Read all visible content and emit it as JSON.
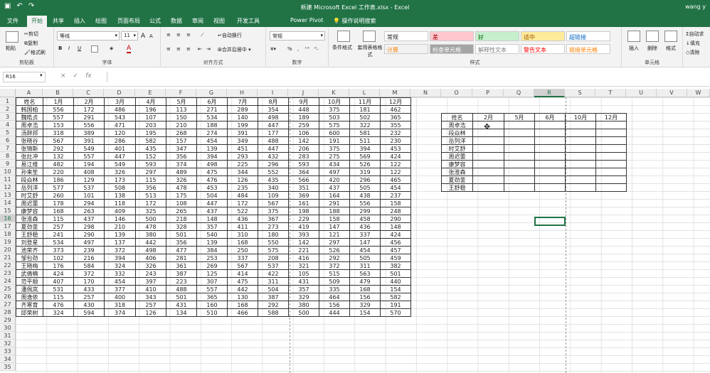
{
  "titlebar": {
    "title": "新建 Microsoft Excel 工作表.xlsx  -  Excel",
    "user": "wang y"
  },
  "menu": {
    "tabs": [
      "文件",
      "开始",
      "共享",
      "插入",
      "绘图",
      "页面布局",
      "公式",
      "数据",
      "审阅",
      "视图",
      "开发工具",
      "Power Pivot",
      "操作说明搜索"
    ],
    "active": "开始"
  },
  "ribbon": {
    "clipboard": {
      "paste": "粘贴",
      "cut": "剪切",
      "copy": "复制",
      "format_painter": "格式刷",
      "label": "剪贴板"
    },
    "font": {
      "name": "等线",
      "size": "11",
      "bold": "B",
      "italic": "I",
      "underline": "U",
      "grow": "A",
      "shrink": "A",
      "color": "A",
      "label": "字体"
    },
    "align": {
      "wrap": "自动换行",
      "merge": "合并后居中",
      "label": "对齐方式"
    },
    "number": {
      "format": "常规",
      "percent": "%",
      "comma": ",",
      "label": "数字"
    },
    "styles": {
      "cond": "条件格式",
      "table": "套用表格格式",
      "label": "样式",
      "cells": [
        {
          "t": "常规",
          "bg": "#ffffff",
          "fg": "#222"
        },
        {
          "t": "差",
          "bg": "#ffc7ce",
          "fg": "#9c0006"
        },
        {
          "t": "好",
          "bg": "#c6efce",
          "fg": "#006100"
        },
        {
          "t": "适中",
          "bg": "#ffeb9c",
          "fg": "#9c5700"
        },
        {
          "t": "超链接",
          "bg": "#ffffff",
          "fg": "#0563c1"
        },
        {
          "t": "计算",
          "bg": "#f2f2f2",
          "fg": "#fa7d00"
        },
        {
          "t": "检查单元格",
          "bg": "#a5a5a5",
          "fg": "#ffffff"
        },
        {
          "t": "解释性文本",
          "bg": "#ffffff",
          "fg": "#7f7f7f"
        },
        {
          "t": "警告文本",
          "bg": "#ffffff",
          "fg": "#ff0000"
        },
        {
          "t": "链接单元格",
          "bg": "#ffffff",
          "fg": "#fa7d00"
        }
      ]
    },
    "cellsgrp": {
      "insert": "插入",
      "delete": "删除",
      "format": "格式",
      "label": "单元格"
    },
    "editing": {
      "autosum": "自动求",
      "fill": "填充",
      "clear": "清除"
    }
  },
  "formula": {
    "namebox": "R16",
    "cancel": "×",
    "enter": "✓",
    "fx": "fx"
  },
  "columns": [
    "A",
    "B",
    "C",
    "D",
    "E",
    "F",
    "G",
    "H",
    "I",
    "J",
    "K",
    "L",
    "M",
    "N",
    "O",
    "P",
    "Q",
    "R",
    "S",
    "T",
    "U",
    "V",
    "W"
  ],
  "selected_col": "R",
  "selected_row": 16,
  "rows": [
    1,
    2,
    3,
    4,
    5,
    6,
    7,
    8,
    9,
    10,
    11,
    12,
    13,
    14,
    15,
    16,
    17,
    18,
    19,
    20,
    21,
    22,
    23,
    24,
    25,
    26,
    27,
    28,
    29,
    30,
    31,
    32,
    33,
    34,
    35
  ],
  "main_table": {
    "header": [
      "姓名",
      "1月",
      "2月",
      "3月",
      "4月",
      "5月",
      "6月",
      "7月",
      "8月",
      "9月",
      "10月",
      "11月",
      "12月"
    ],
    "data": [
      [
        "韩国柏",
        "556",
        "172",
        "486",
        "196",
        "113",
        "271",
        "289",
        "354",
        "448",
        "375",
        "181",
        "462"
      ],
      [
        "魏皓贞",
        "557",
        "291",
        "543",
        "107",
        "150",
        "534",
        "140",
        "498",
        "189",
        "503",
        "502",
        "365"
      ],
      [
        "周卓浩",
        "153",
        "556",
        "471",
        "203",
        "210",
        "188",
        "199",
        "447",
        "259",
        "575",
        "322",
        "355"
      ],
      [
        "汤辞邦",
        "318",
        "389",
        "120",
        "195",
        "268",
        "274",
        "391",
        "177",
        "106",
        "600",
        "581",
        "232"
      ],
      [
        "张晓谷",
        "567",
        "391",
        "286",
        "582",
        "157",
        "454",
        "349",
        "488",
        "142",
        "191",
        "511",
        "230"
      ],
      [
        "张锦斯",
        "292",
        "549",
        "401",
        "435",
        "347",
        "139",
        "451",
        "447",
        "206",
        "375",
        "394",
        "453"
      ],
      [
        "张灶冲",
        "132",
        "557",
        "447",
        "152",
        "356",
        "394",
        "293",
        "432",
        "283",
        "275",
        "569",
        "424"
      ],
      [
        "易江维",
        "482",
        "194",
        "549",
        "593",
        "374",
        "498",
        "225",
        "296",
        "593",
        "434",
        "526",
        "122"
      ],
      [
        "孙来笙",
        "220",
        "408",
        "326",
        "297",
        "489",
        "475",
        "344",
        "552",
        "364",
        "497",
        "319",
        "122"
      ],
      [
        "段焱林",
        "186",
        "129",
        "173",
        "115",
        "326",
        "476",
        "126",
        "435",
        "566",
        "420",
        "296",
        "465"
      ],
      [
        "岳列洋",
        "577",
        "537",
        "508",
        "356",
        "478",
        "453",
        "235",
        "340",
        "351",
        "437",
        "505",
        "454"
      ],
      [
        "时艾舒",
        "260",
        "101",
        "138",
        "513",
        "175",
        "504",
        "484",
        "109",
        "369",
        "164",
        "438",
        "237"
      ],
      [
        "周迟蕾",
        "178",
        "294",
        "118",
        "172",
        "108",
        "447",
        "172",
        "567",
        "161",
        "291",
        "556",
        "158"
      ],
      [
        "康梦容",
        "168",
        "263",
        "409",
        "325",
        "265",
        "437",
        "522",
        "375",
        "198",
        "188",
        "299",
        "248"
      ],
      [
        "张淮森",
        "115",
        "437",
        "146",
        "500",
        "218",
        "148",
        "436",
        "367",
        "229",
        "158",
        "458",
        "290"
      ],
      [
        "夏劲釜",
        "257",
        "298",
        "210",
        "478",
        "328",
        "357",
        "411",
        "273",
        "419",
        "147",
        "436",
        "148"
      ],
      [
        "王舒稳",
        "241",
        "290",
        "139",
        "380",
        "501",
        "540",
        "310",
        "180",
        "393",
        "121",
        "337",
        "424"
      ],
      [
        "刘登星",
        "534",
        "497",
        "137",
        "442",
        "356",
        "139",
        "168",
        "550",
        "142",
        "297",
        "147",
        "456"
      ],
      [
        "池荣齐",
        "373",
        "239",
        "372",
        "498",
        "477",
        "384",
        "250",
        "575",
        "221",
        "526",
        "454",
        "457"
      ],
      [
        "邹包劲",
        "102",
        "216",
        "394",
        "406",
        "281",
        "253",
        "337",
        "208",
        "416",
        "292",
        "505",
        "459"
      ],
      [
        "王晓梅",
        "176",
        "584",
        "324",
        "326",
        "361",
        "269",
        "567",
        "537",
        "321",
        "372",
        "311",
        "382"
      ],
      [
        "武倩楠",
        "424",
        "372",
        "332",
        "243",
        "387",
        "125",
        "414",
        "422",
        "105",
        "515",
        "563",
        "501"
      ],
      [
        "范平顺",
        "407",
        "170",
        "454",
        "397",
        "223",
        "307",
        "475",
        "311",
        "431",
        "509",
        "479",
        "440"
      ],
      [
        "潘佩岚",
        "531",
        "433",
        "377",
        "410",
        "488",
        "557",
        "442",
        "504",
        "357",
        "335",
        "168",
        "154"
      ],
      [
        "周逸依",
        "115",
        "257",
        "400",
        "343",
        "501",
        "365",
        "130",
        "387",
        "329",
        "464",
        "156",
        "582"
      ],
      [
        "齐寒育",
        "476",
        "430",
        "318",
        "257",
        "431",
        "160",
        "168",
        "292",
        "380",
        "156",
        "329",
        "191"
      ],
      [
        "邱荣树",
        "324",
        "594",
        "374",
        "126",
        "134",
        "510",
        "466",
        "588",
        "500",
        "444",
        "154",
        "570"
      ]
    ]
  },
  "lookup_table": {
    "header": [
      "姓名",
      "2月",
      "5月",
      "6月",
      "10月",
      "12月"
    ],
    "names": [
      "周卓浩",
      "段焱林",
      "岳列洋",
      "时艾舒",
      "周迟蕾",
      "康梦容",
      "张淮森",
      "夏劲釜",
      "王舒稳"
    ]
  }
}
